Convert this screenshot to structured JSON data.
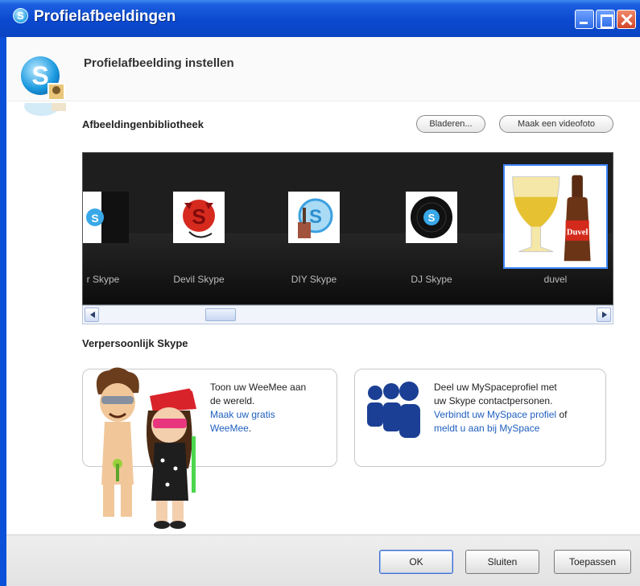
{
  "window": {
    "title": "Profielafbeeldingen"
  },
  "header": {
    "title": "Profielafbeelding instellen"
  },
  "library": {
    "title": "Afbeeldingenbibliotheek",
    "browse_label": "Bladeren...",
    "video_label": "Maak een videofoto",
    "items": [
      {
        "label": "r Skype"
      },
      {
        "label": "Devil Skype"
      },
      {
        "label": "DIY Skype"
      },
      {
        "label": "DJ Skype"
      },
      {
        "label": "duvel"
      }
    ]
  },
  "personalize": {
    "title": "Verpersoonlijk Skype",
    "weemee": {
      "line1": "Toon uw WeeMee aan",
      "line2": "de wereld.",
      "link1": "Maak uw gratis",
      "link2": "WeeMee"
    },
    "myspace": {
      "line1": "Deel uw MySpaceprofiel met",
      "line2": "uw Skype contactpersonen.",
      "link1": "Verbindt uw MySpace profiel",
      "mid": "of",
      "link2": "meldt u aan bij MySpace"
    }
  },
  "footer": {
    "ok_label": "OK",
    "close_label": "Sluiten",
    "apply_label": "Toepassen"
  },
  "colors": {
    "titlebar": "#0b49cf",
    "link": "#1f5fbf",
    "gallery_bg": "#1e1e1e",
    "selection": "#3d86ff"
  }
}
